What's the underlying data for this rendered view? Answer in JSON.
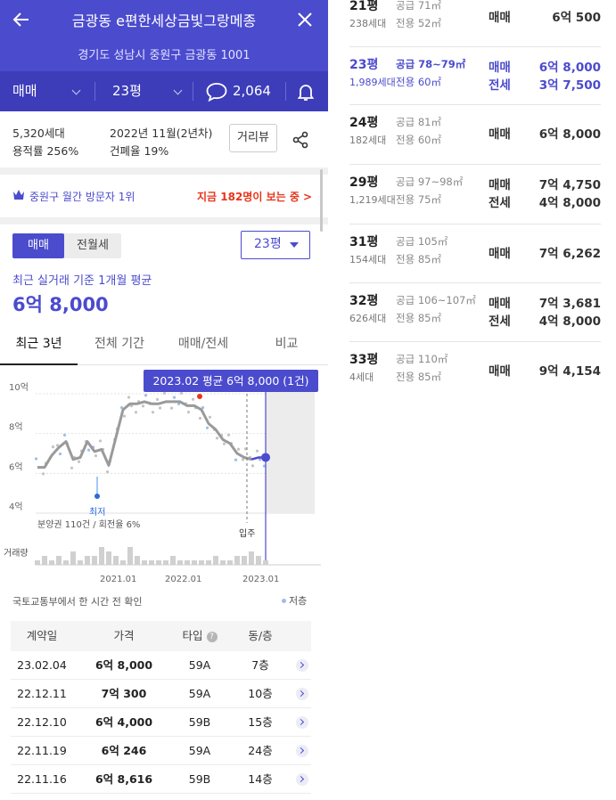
{
  "header": {
    "title": "금광동 e편한세상금빛그랑메종",
    "address": "경기도 성남시 중원구 금광동 1001"
  },
  "filters": {
    "deal_type": "매매",
    "pyeong": "23평",
    "comment_count": "2,064"
  },
  "complex_info": {
    "households": "5,320세대",
    "floor_area_ratio": "용적률 256%",
    "built": "2022년 11월(2년차)",
    "coverage_ratio": "건폐율 19%",
    "street_view_label": "거리뷰"
  },
  "visit": {
    "rank_text": "중원구 월간 방문자 1위",
    "live_text": "지금 182명이 보는 중 >"
  },
  "price_section": {
    "seg_buy": "매매",
    "seg_rent": "전월세",
    "size_select": "23평",
    "avg_label": "최근 실거래 기준 1개월 평균",
    "avg_value": "6억 8,000"
  },
  "chart_tabs": [
    "최근 3년",
    "전체 기간",
    "매매/전세",
    "비교"
  ],
  "chart_data": {
    "type": "line",
    "tooltip": "2023.02 평균 6억 8,000 (1건)",
    "y_ticks": [
      "10억",
      "8억",
      "6억",
      "4억"
    ],
    "x_ticks": [
      "2021.01",
      "2022.01",
      "2023.01"
    ],
    "ylim": [
      4,
      10
    ],
    "y_unit": "억",
    "min_label": "최저",
    "move_in_label": "입주",
    "presale_note": "분양권 110건 / 회전율 6%",
    "volume_label": "거래량",
    "series": [
      {
        "x": [
          "2020-05",
          "2020-07",
          "2020-08",
          "2020-09",
          "2020-10",
          "2020-11",
          "2020-12",
          "2021-01",
          "2021-02",
          "2021-03",
          "2021-04",
          "2021-05",
          "2021-06",
          "2021-07",
          "2021-08",
          "2021-09",
          "2021-10",
          "2021-11",
          "2021-12",
          "2022-01",
          "2022-02",
          "2022-03",
          "2022-04",
          "2022-05",
          "2022-06",
          "2022-07",
          "2022-08",
          "2022-09",
          "2022-10",
          "2022-11",
          "2022-12",
          "2023-01",
          "2023-02"
        ],
        "y": [
          6.3,
          6.3,
          6.9,
          7.3,
          7.6,
          6.7,
          6.8,
          7.6,
          7.1,
          7.2,
          6.4,
          7.8,
          9.2,
          9.5,
          9.5,
          9.6,
          9.5,
          9.5,
          9.6,
          9.6,
          9.6,
          9.4,
          9.4,
          9.2,
          8.5,
          8.2,
          7.7,
          7.5,
          7.0,
          6.8,
          6.7,
          6.8,
          6.8
        ]
      }
    ],
    "volume": [
      1,
      2,
      1,
      2,
      1,
      3,
      1,
      2,
      2,
      4,
      3,
      2,
      1,
      4,
      2,
      1,
      1,
      1,
      1,
      2,
      1,
      1,
      1,
      1,
      1,
      2,
      1,
      1,
      2,
      2,
      3,
      2,
      1
    ],
    "legend": "저층"
  },
  "data_source": "국토교통부에서 한 시간 전 확인",
  "table": {
    "headers": [
      "계약일",
      "가격",
      "타입",
      "동/층"
    ],
    "rows": [
      [
        "23.02.04",
        "6억 8,000",
        "59A",
        "7층"
      ],
      [
        "22.12.11",
        "7억 300",
        "59A",
        "10층"
      ],
      [
        "22.12.10",
        "6억 4,000",
        "59B",
        "15층"
      ],
      [
        "22.11.19",
        "6억 246",
        "59A",
        "24층"
      ],
      [
        "22.11.16",
        "6억 8,616",
        "59B",
        "14층"
      ]
    ]
  },
  "size_list": [
    {
      "pyeong": "21평",
      "households": "238세대",
      "supply": "공급 71㎡",
      "net": "전용 52㎡",
      "types": [
        "매매"
      ],
      "prices": [
        "6억 500"
      ],
      "highlight": false
    },
    {
      "pyeong": "23평",
      "households": "1,989세대",
      "supply": "공급 78~79㎡",
      "net": "전용 60㎡",
      "types": [
        "매매",
        "전세"
      ],
      "prices": [
        "6억 8,000",
        "3억 7,500"
      ],
      "highlight": true
    },
    {
      "pyeong": "24평",
      "households": "182세대",
      "supply": "공급 81㎡",
      "net": "전용 60㎡",
      "types": [
        "매매"
      ],
      "prices": [
        "6억 8,000"
      ],
      "highlight": false
    },
    {
      "pyeong": "29평",
      "households": "1,219세대",
      "supply": "공급 97~98㎡",
      "net": "전용 75㎡",
      "types": [
        "매매",
        "전세"
      ],
      "prices": [
        "7억 4,750",
        "4억 8,000"
      ],
      "highlight": false
    },
    {
      "pyeong": "31평",
      "households": "154세대",
      "supply": "공급 105㎡",
      "net": "전용 85㎡",
      "types": [
        "매매"
      ],
      "prices": [
        "7억 6,262"
      ],
      "highlight": false
    },
    {
      "pyeong": "32평",
      "households": "626세대",
      "supply": "공급 106~107㎡",
      "net": "전용 85㎡",
      "types": [
        "매매",
        "전세"
      ],
      "prices": [
        "7억 3,681",
        "4억 8,000"
      ],
      "highlight": false
    },
    {
      "pyeong": "33평",
      "households": "4세대",
      "supply": "공급 110㎡",
      "net": "전용 85㎡",
      "types": [
        "매매"
      ],
      "prices": [
        "9억 4,154"
      ],
      "highlight": false
    }
  ],
  "colors": {
    "brand": "#4b4bce",
    "header_dark": "#3d3dba",
    "alert": "#e8341c",
    "line": "#9a9a9a"
  }
}
